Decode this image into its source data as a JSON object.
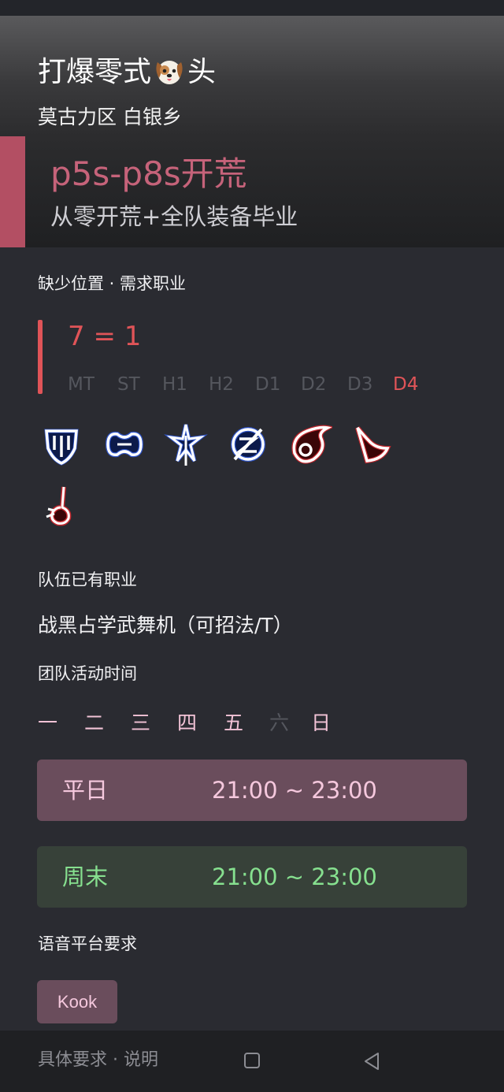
{
  "header": {
    "team_name_prefix": "打爆零式",
    "team_name_suffix": "头",
    "server": "莫古力区 白银乡"
  },
  "banner": {
    "title": "p5s-p8s开荒",
    "subtitle": "从零开荒+全队装备毕业"
  },
  "need": {
    "label": "缺少位置 · 需求职业",
    "count_text": "7 = 1",
    "positions": [
      {
        "label": "MT",
        "active": false
      },
      {
        "label": "ST",
        "active": false
      },
      {
        "label": "H1",
        "active": false
      },
      {
        "label": "H2",
        "active": false
      },
      {
        "label": "D1",
        "active": false
      },
      {
        "label": "D2",
        "active": false
      },
      {
        "label": "D3",
        "active": false
      },
      {
        "label": "D4",
        "active": true
      }
    ],
    "job_icons": [
      {
        "name": "paladin-shield-icon",
        "role": "tank"
      },
      {
        "name": "dark-knight-icon",
        "role": "tank"
      },
      {
        "name": "white-mage-icon",
        "role": "healer"
      },
      {
        "name": "scholar-icon",
        "role": "healer"
      },
      {
        "name": "black-mage-icon",
        "role": "dps"
      },
      {
        "name": "bard-icon",
        "role": "dps"
      },
      {
        "name": "red-mage-icon",
        "role": "dps"
      }
    ]
  },
  "roles": {
    "label": "队伍已有职业",
    "text": "战黑占学武舞机（可招法/T）"
  },
  "schedule": {
    "label": "团队活动时间",
    "days": [
      {
        "label": "一",
        "active": true
      },
      {
        "label": "二",
        "active": true
      },
      {
        "label": "三",
        "active": true
      },
      {
        "label": "四",
        "active": true
      },
      {
        "label": "五",
        "active": true
      },
      {
        "label": "六",
        "active": false
      },
      {
        "label": "日",
        "active": true
      }
    ],
    "weekday": {
      "label": "平日",
      "time": "21:00 ~ 23:00"
    },
    "weekend": {
      "label": "周末",
      "time": "21:00 ~ 23:00"
    }
  },
  "voice": {
    "label": "语音平台要求",
    "tag": "Kook"
  },
  "bottom": {
    "text": "具体要求 · 说明"
  },
  "colors": {
    "accent_pink": "#c6637a",
    "need_red": "#e05458",
    "weekday_bg": "#6a4d5c",
    "weekend_bg": "#374139",
    "weekend_text": "#86e08f",
    "tank_glow": "#2f55c9",
    "dps_glow": "#c1272d"
  }
}
